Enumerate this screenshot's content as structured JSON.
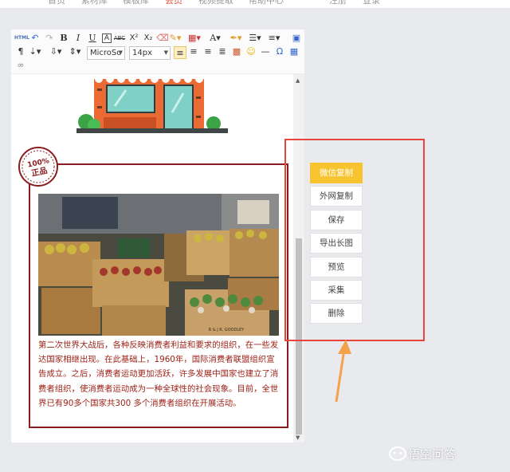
{
  "nav": {
    "items": [
      "首页",
      "素材库",
      "模板库",
      "会员",
      "视频提取",
      "帮助中心"
    ],
    "active_index": 3,
    "right": [
      "注册",
      "登录"
    ]
  },
  "toolbar": {
    "html_label": "HTML",
    "bold": "B",
    "italic": "I",
    "underline": "U",
    "font_color": "A",
    "strike": "ABC",
    "superscript": "X²",
    "subscript": "X₂",
    "font_family": "MicroSo",
    "font_size": "14px",
    "omega": "Ω"
  },
  "article": {
    "text": "第二次世界大战后，各种反映消费者利益和要求的组织，在一些发达国家相继出现。在此基础上，1960年，国际消费者联盟组织宣告成立。之后，消费者运动更加活跃，许多发展中国家也建立了消费者组织，使消费者运动成为一种全球性的社会现象。目前，全世界已有90多个国家共300 多个消费者组织在开展活动。"
  },
  "badge": {
    "percent": "100%",
    "label": "正品"
  },
  "photo": {
    "crate_text": "R & J R. GOODLEY"
  },
  "actions": [
    {
      "label": "微信复制",
      "primary": true
    },
    {
      "label": "外网复制",
      "primary": false
    },
    {
      "label": "保存",
      "primary": false
    },
    {
      "label": "导出长图",
      "primary": false
    },
    {
      "label": "预览",
      "primary": false
    },
    {
      "label": "采集",
      "primary": false
    },
    {
      "label": "删除",
      "primary": false
    }
  ],
  "watermark": "悟空问答",
  "colors": {
    "primary_button": "#f7c430",
    "highlight_border": "#e8453c",
    "frame_border": "#8a1d20",
    "arrow": "#f3a24a",
    "article_text": "#9c1f14"
  }
}
